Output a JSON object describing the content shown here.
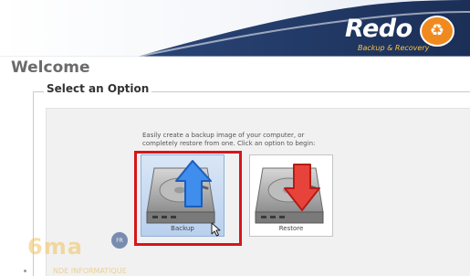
{
  "header": {
    "logo_word": "Redo",
    "logo_subtitle": "Backup & Recovery",
    "logo_badge_icon": "recycle-icon",
    "colors": {
      "swoosh": "#233c6a",
      "logo_accent": "#f08a1e"
    }
  },
  "page": {
    "title": "Welcome",
    "group_title": "Select an Option",
    "instructions_line1": "Easily create a backup image of your computer, or",
    "instructions_line2": "completely restore from one.  Click an option to begin:"
  },
  "options": [
    {
      "label": "Backup",
      "icon": "hard-drive-upload-icon",
      "arrow_color": "#2f7fe6",
      "selected": true
    },
    {
      "label": "Restore",
      "icon": "hard-drive-download-icon",
      "arrow_color": "#e53a33",
      "selected": false
    }
  ],
  "annotation": {
    "highlight_color": "#d6161a"
  },
  "watermark": {
    "text": "6ma",
    "badge": "FR",
    "subtext": "NDE INFORMATIQUE"
  }
}
